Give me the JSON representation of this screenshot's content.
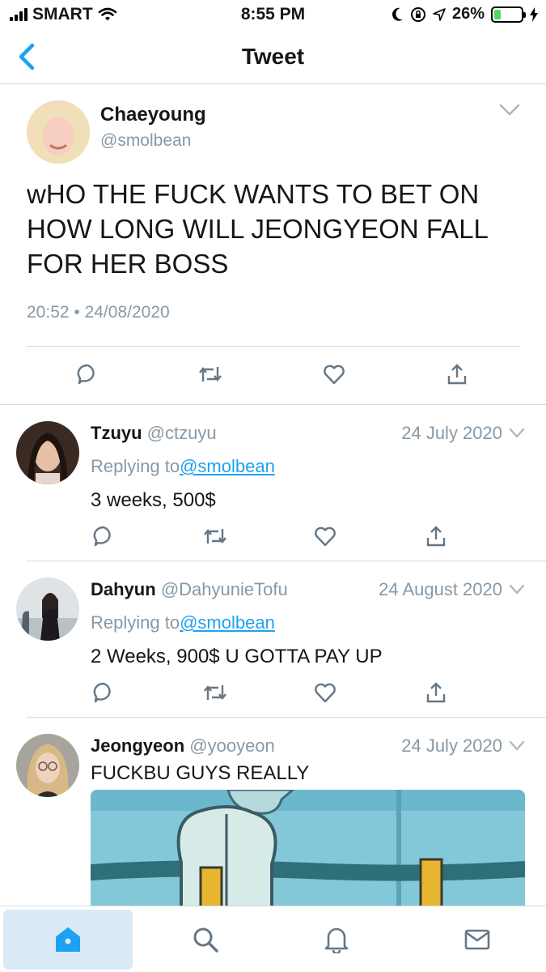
{
  "status_bar": {
    "carrier": "SMART",
    "time": "8:55 PM",
    "battery": "26%",
    "battery_level": 0.26
  },
  "nav": {
    "title": "Tweet"
  },
  "main_tweet": {
    "name": "Chaeyoung",
    "handle": "@smolbean",
    "text": "wHO THE FUCK WANTS TO BET ON HOW LONG WILL JEONGYEON FALL FOR HER BOSS",
    "timestamp": "20:52 • 24/08/2020"
  },
  "replies": [
    {
      "name": "Tzuyu",
      "handle": "@ctzuyu",
      "date": "24 July 2020",
      "replying_prefix": "Replying to",
      "replying_to": "@smolbean",
      "text": "3 weeks, 500$"
    },
    {
      "name": "Dahyun",
      "handle": "@DahyunieTofu",
      "date": "24 August 2020",
      "replying_prefix": "Replying to",
      "replying_to": "@smolbean",
      "text": "2 Weeks, 900$ U GOTTA PAY UP"
    },
    {
      "name": "Jeongyeon",
      "handle": "@yooyeon",
      "date": "24 July 2020",
      "text": "FUCKBU GUYS REALLY"
    }
  ],
  "tabbar": {
    "tabs": [
      "home-icon",
      "search-icon",
      "notifications-icon",
      "messages-icon"
    ],
    "active": "home-icon"
  },
  "colors": {
    "accent": "#1da1f2",
    "secondary_text": "#8899a6",
    "divider": "#d6d9dc",
    "active_tab_bg": "#d9e9f6"
  }
}
